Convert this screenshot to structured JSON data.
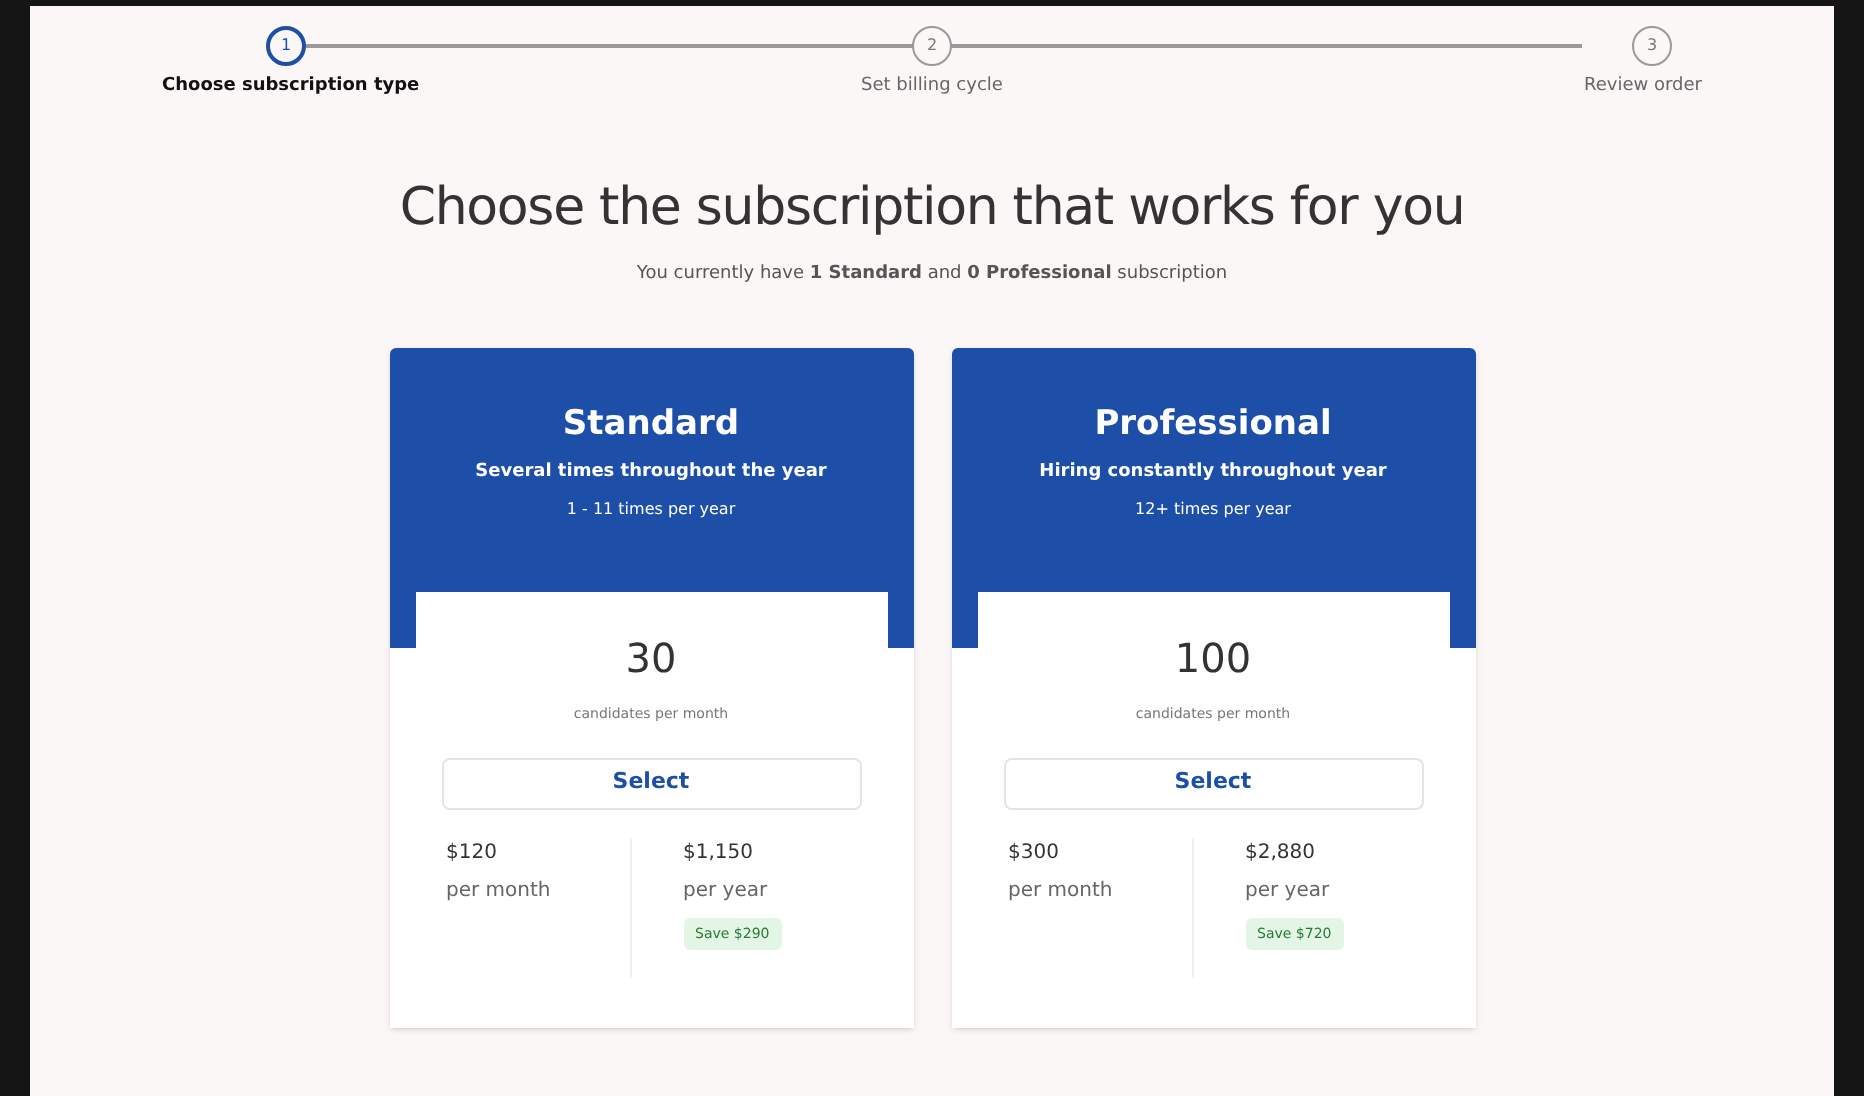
{
  "steps": [
    {
      "number": "1",
      "label": "Choose subscription type",
      "selected": true
    },
    {
      "number": "2",
      "label": "Set billing cycle",
      "selected": false
    },
    {
      "number": "3",
      "label": "Review order",
      "selected": false
    }
  ],
  "heading": "Choose the subscription that works for you",
  "subheading": "You currently have **1 Standard** and **0 Professional** subscription",
  "plans": [
    {
      "name": "Standard",
      "tagline": "Several times throughout the year",
      "frequency": "1 - 11 times per year",
      "count": "30",
      "count_label": "candidates per month",
      "button": "Select",
      "monthly_price": "$120",
      "monthly_label": "per month",
      "yearly_price": "$1,150",
      "yearly_label": "per year",
      "saving": "Save $290"
    },
    {
      "name": "Professional",
      "tagline": "Hiring constantly throughout year",
      "frequency": "12+ times per year",
      "count": "100",
      "count_label": "candidates per month",
      "button": "Select",
      "monthly_price": "$300",
      "monthly_label": "per month",
      "yearly_price": "$2,880",
      "yearly_label": "per year",
      "saving": "Save $720"
    }
  ]
}
